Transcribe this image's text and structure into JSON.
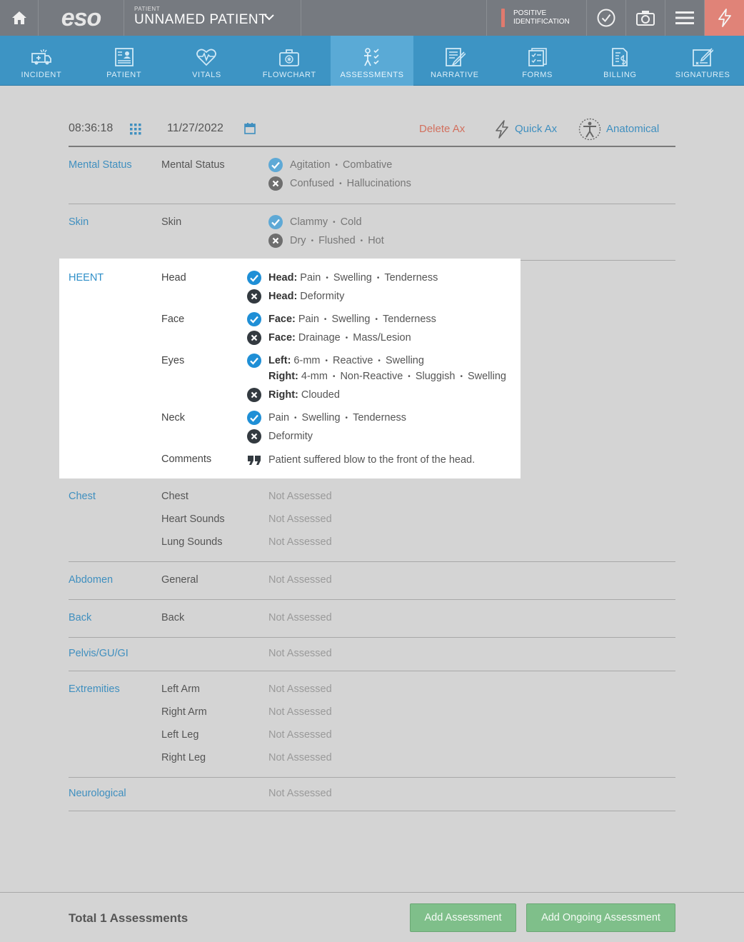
{
  "topbar": {
    "logo": "eso",
    "patient_label": "PATIENT",
    "patient_name": "UNNAMED PATIENT",
    "posid_line1": "POSITIVE",
    "posid_line2": "IDENTIFICATION"
  },
  "nav": {
    "items": [
      {
        "label": "INCIDENT",
        "icon": "ambulance-icon"
      },
      {
        "label": "PATIENT",
        "icon": "patient-card-icon"
      },
      {
        "label": "VITALS",
        "icon": "heart-pulse-icon"
      },
      {
        "label": "FLOWCHART",
        "icon": "medkit-icon"
      },
      {
        "label": "ASSESSMENTS",
        "icon": "person-checklist-icon"
      },
      {
        "label": "NARRATIVE",
        "icon": "notepad-pen-icon"
      },
      {
        "label": "FORMS",
        "icon": "forms-checklist-icon"
      },
      {
        "label": "BILLING",
        "icon": "invoice-dollar-icon"
      },
      {
        "label": "SIGNATURES",
        "icon": "signature-icon"
      }
    ],
    "active": "ASSESSMENTS"
  },
  "header": {
    "time": "08:36:18",
    "date": "11/27/2022",
    "delete": "Delete Ax",
    "quick": "Quick Ax",
    "anatomical": "Anatomical"
  },
  "mental_status": {
    "name": "Mental Status",
    "label": "Mental Status",
    "yes": [
      "Agitation",
      "Combative"
    ],
    "no": [
      "Confused",
      "Hallucinations"
    ]
  },
  "skin": {
    "name": "Skin",
    "label": "Skin",
    "yes": [
      "Clammy",
      "Cold"
    ],
    "no": [
      "Dry",
      "Flushed",
      "Hot"
    ]
  },
  "heent": {
    "name": "HEENT",
    "head_label": "Head",
    "head_yes_prefix": "Head:",
    "head_yes": [
      "Pain",
      "Swelling",
      "Tenderness"
    ],
    "head_no_prefix": "Head:",
    "head_no": "Deformity",
    "face_label": "Face",
    "face_yes_prefix": "Face:",
    "face_yes": [
      "Pain",
      "Swelling",
      "Tenderness"
    ],
    "face_no_prefix": "Face:",
    "face_no": [
      "Drainage",
      "Mass/Lesion"
    ],
    "eyes_label": "Eyes",
    "eyes_left_prefix": "Left:",
    "eyes_left": [
      "6-mm",
      "Reactive",
      "Swelling"
    ],
    "eyes_right_prefix": "Right:",
    "eyes_right": [
      "4-mm",
      "Non-Reactive",
      "Sluggish",
      "Swelling"
    ],
    "eyes_no_prefix": "Right:",
    "eyes_no": "Clouded",
    "neck_label": "Neck",
    "neck_yes": [
      "Pain",
      "Swelling",
      "Tenderness"
    ],
    "neck_no": "Deformity",
    "comments_label": "Comments",
    "comments": "Patient suffered blow to the front of the head."
  },
  "chest": {
    "name": "Chest",
    "rows": [
      {
        "label": "Chest",
        "value": "Not Assessed"
      },
      {
        "label": "Heart Sounds",
        "value": "Not Assessed"
      },
      {
        "label": "Lung Sounds",
        "value": "Not Assessed"
      }
    ]
  },
  "abdomen": {
    "name": "Abdomen",
    "label": "General",
    "value": "Not Assessed"
  },
  "back": {
    "name": "Back",
    "label": "Back",
    "value": "Not Assessed"
  },
  "pelvis": {
    "name": "Pelvis/GU/GI",
    "value": "Not Assessed"
  },
  "extremities": {
    "name": "Extremities",
    "rows": [
      {
        "label": "Left Arm",
        "value": "Not Assessed"
      },
      {
        "label": "Right Arm",
        "value": "Not Assessed"
      },
      {
        "label": "Left Leg",
        "value": "Not Assessed"
      },
      {
        "label": "Right Leg",
        "value": "Not Assessed"
      }
    ]
  },
  "neuro": {
    "name": "Neurological",
    "value": "Not Assessed"
  },
  "footer": {
    "total": "Total 1 Assessments",
    "add": "Add Assessment",
    "add_ongoing": "Add Ongoing Assessment"
  },
  "colors": {
    "topbar": "#767a80",
    "nav": "#3d94c4",
    "nav_active": "#5aaad6",
    "accent": "#3f8fbf",
    "delete": "#d2705e",
    "button": "#7fbf8a",
    "alert": "#e08378"
  }
}
